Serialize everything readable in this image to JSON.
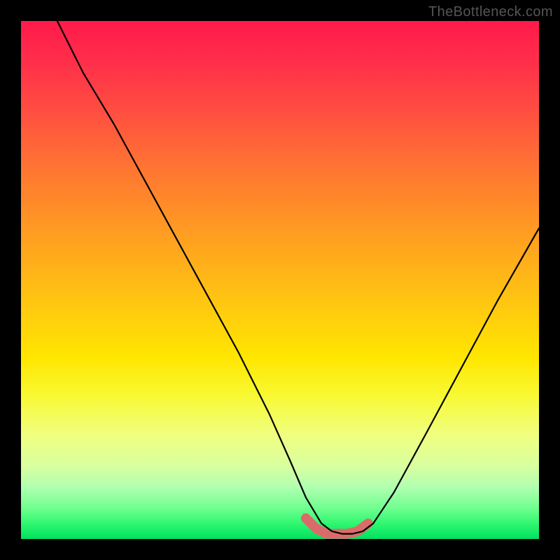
{
  "watermark": "TheBottleneck.com",
  "colors": {
    "gradient_top": "#ff1a4a",
    "gradient_mid": "#ffe600",
    "gradient_bottom": "#00e060",
    "curve": "#000000",
    "curve_highlight": "#db6b6b",
    "frame": "#000000"
  },
  "chart_data": {
    "type": "line",
    "title": "",
    "xlabel": "",
    "ylabel": "",
    "xlim": [
      0,
      100
    ],
    "ylim": [
      0,
      100
    ],
    "grid": false,
    "legend": false,
    "description": "V-shaped bottleneck curve over a red→green vertical gradient. Minimum plateau around x≈58–66. Black curve descends steeply from top-left, flattens near bottom, then rises to mid-right. Coral segment highlights the near-zero plateau.",
    "series": [
      {
        "name": "bottleneck-curve",
        "x": [
          7,
          12,
          18,
          24,
          30,
          36,
          42,
          48,
          52,
          55,
          58,
          60,
          62,
          64,
          66,
          68,
          72,
          78,
          85,
          92,
          100
        ],
        "y": [
          100,
          90,
          80,
          69,
          58,
          47,
          36,
          24,
          15,
          8,
          3,
          1.5,
          1,
          1,
          1.5,
          3,
          9,
          20,
          33,
          46,
          60
        ]
      },
      {
        "name": "highlight-plateau",
        "x": [
          55,
          57,
          59,
          61,
          63,
          65,
          67
        ],
        "y": [
          4,
          2,
          1,
          1,
          1,
          1.5,
          3
        ]
      }
    ]
  }
}
